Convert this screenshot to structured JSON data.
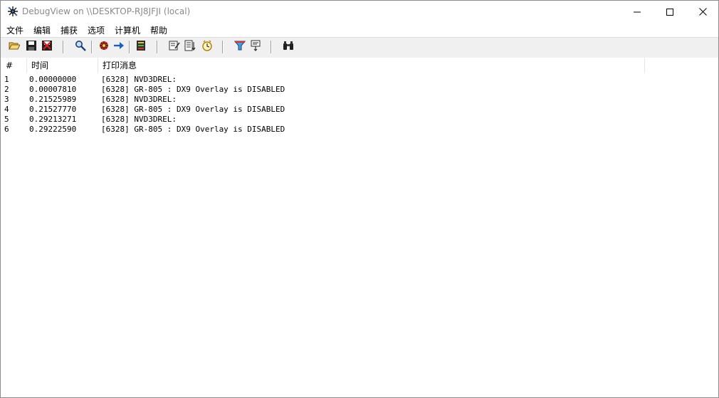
{
  "window": {
    "title": "DebugView on \\\\DESKTOP-RJ8JFJI (local)"
  },
  "menu": {
    "items": [
      "文件",
      "编辑",
      "捕获",
      "选项",
      "计算机",
      "帮助"
    ]
  },
  "toolbar": {
    "buttons": [
      {
        "name": "open-icon"
      },
      {
        "name": "save-icon"
      },
      {
        "name": "clear-display-icon"
      },
      {
        "name": "find-icon"
      },
      {
        "name": "capture-icon"
      },
      {
        "name": "autoscroll-icon"
      },
      {
        "name": "history-depth-icon"
      },
      {
        "name": "highlight-icon"
      },
      {
        "name": "time-format-icon"
      },
      {
        "name": "clock-icon"
      },
      {
        "name": "filter-icon"
      },
      {
        "name": "filter-settings-icon"
      },
      {
        "name": "search-binoculars-icon"
      }
    ]
  },
  "list": {
    "columns": [
      "#",
      "时间",
      "打印消息"
    ],
    "rows": [
      {
        "idx": "1",
        "time": "0.00000000",
        "msg": "[6328] NVD3DREL:"
      },
      {
        "idx": "2",
        "time": "0.00007810",
        "msg": "[6328] GR-805 : DX9 Overlay is DISABLED"
      },
      {
        "idx": "3",
        "time": "0.21525989",
        "msg": "[6328] NVD3DREL:"
      },
      {
        "idx": "4",
        "time": "0.21527770",
        "msg": "[6328] GR-805 : DX9 Overlay is DISABLED"
      },
      {
        "idx": "5",
        "time": "0.29213271",
        "msg": "[6328] NVD3DREL:"
      },
      {
        "idx": "6",
        "time": "0.29222590",
        "msg": "[6328] GR-805 : DX9 Overlay is DISABLED"
      }
    ]
  }
}
